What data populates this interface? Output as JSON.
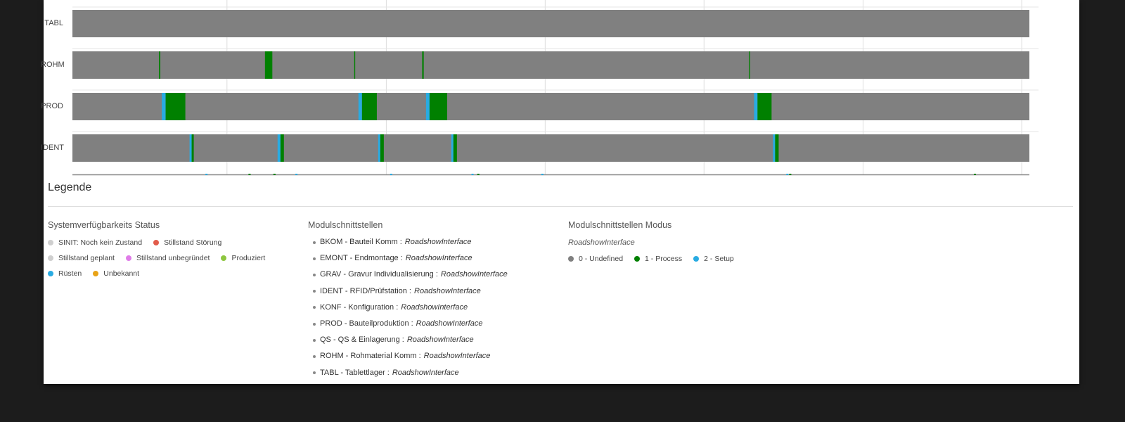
{
  "chart_data": {
    "type": "timeline",
    "rows": [
      {
        "label": "TABL",
        "segments": []
      },
      {
        "label": "ROHM",
        "segments": [
          {
            "start": 0.0905,
            "end": 0.0918,
            "mode": "1"
          },
          {
            "start": 0.2012,
            "end": 0.2089,
            "mode": "1"
          },
          {
            "start": 0.2945,
            "end": 0.2955,
            "mode": "1"
          },
          {
            "start": 0.3655,
            "end": 0.3671,
            "mode": "1"
          },
          {
            "start": 0.7071,
            "end": 0.7081,
            "mode": "1"
          }
        ]
      },
      {
        "label": "PROD",
        "segments": [
          {
            "start": 0.0934,
            "end": 0.0974,
            "mode": "2"
          },
          {
            "start": 0.0974,
            "end": 0.118,
            "mode": "1"
          },
          {
            "start": 0.2989,
            "end": 0.3026,
            "mode": "2"
          },
          {
            "start": 0.3026,
            "end": 0.3181,
            "mode": "1"
          },
          {
            "start": 0.3695,
            "end": 0.3732,
            "mode": "2"
          },
          {
            "start": 0.3732,
            "end": 0.3916,
            "mode": "1"
          },
          {
            "start": 0.7123,
            "end": 0.7159,
            "mode": "2"
          },
          {
            "start": 0.7159,
            "end": 0.7306,
            "mode": "1"
          }
        ]
      },
      {
        "label": "IDENT",
        "segments": [
          {
            "start": 0.1224,
            "end": 0.1246,
            "mode": "2"
          },
          {
            "start": 0.1246,
            "end": 0.1268,
            "mode": "1"
          },
          {
            "start": 0.2144,
            "end": 0.2174,
            "mode": "2"
          },
          {
            "start": 0.2174,
            "end": 0.221,
            "mode": "1"
          },
          {
            "start": 0.3195,
            "end": 0.3217,
            "mode": "2"
          },
          {
            "start": 0.3217,
            "end": 0.3254,
            "mode": "1"
          },
          {
            "start": 0.3959,
            "end": 0.3981,
            "mode": "2"
          },
          {
            "start": 0.3981,
            "end": 0.4018,
            "mode": "1"
          },
          {
            "start": 0.7321,
            "end": 0.7343,
            "mode": "2"
          },
          {
            "start": 0.7343,
            "end": 0.738,
            "mode": "1"
          }
        ]
      }
    ],
    "bottom_ticks": [
      {
        "pos": 0.139,
        "mode": "2"
      },
      {
        "pos": 0.184,
        "mode": "1"
      },
      {
        "pos": 0.21,
        "mode": "1"
      },
      {
        "pos": 0.233,
        "mode": "2"
      },
      {
        "pos": 0.332,
        "mode": "2"
      },
      {
        "pos": 0.417,
        "mode": "2"
      },
      {
        "pos": 0.423,
        "mode": "1"
      },
      {
        "pos": 0.49,
        "mode": "2"
      },
      {
        "pos": 0.746,
        "mode": "2"
      },
      {
        "pos": 0.749,
        "mode": "1"
      },
      {
        "pos": 0.942,
        "mode": "1"
      }
    ],
    "gridlines": [
      0.1615,
      0.328,
      0.494,
      0.66,
      0.8262,
      0.992
    ]
  },
  "legend": {
    "title": "Legende",
    "status": {
      "title": "Systemverfügbarkeits Status",
      "items": [
        {
          "label": "SINIT: Noch kein Zustand",
          "color": "#cfcfcf"
        },
        {
          "label": "Stillstand Störung",
          "color": "#e25c4b"
        },
        {
          "label": "Stillstand geplant",
          "color": "#cfcfcf"
        },
        {
          "label": "Stillstand unbegründet",
          "color": "#e07ce8"
        },
        {
          "label": "Produziert",
          "color": "#8dc63f"
        },
        {
          "label": "Rüsten",
          "color": "#29abe2"
        },
        {
          "label": "Unbekannt",
          "color": "#e8a317"
        }
      ]
    },
    "modules": {
      "title": "Modulschnittstellen",
      "items": [
        {
          "name": "BKOM - Bauteil Komm :",
          "iface": "RoadshowInterface"
        },
        {
          "name": "EMONT - Endmontage :",
          "iface": "RoadshowInterface"
        },
        {
          "name": "GRAV - Gravur Individualisierung :",
          "iface": "RoadshowInterface"
        },
        {
          "name": "IDENT - RFID/Prüfstation :",
          "iface": "RoadshowInterface"
        },
        {
          "name": "KONF - Konfiguration :",
          "iface": "RoadshowInterface"
        },
        {
          "name": "PROD - Bauteilproduktion :",
          "iface": "RoadshowInterface"
        },
        {
          "name": "QS - QS & Einlagerung :",
          "iface": "RoadshowInterface"
        },
        {
          "name": "ROHM - Rohmaterial Komm :",
          "iface": "RoadshowInterface"
        },
        {
          "name": "TABL - Tablettlager :",
          "iface": "RoadshowInterface"
        }
      ]
    },
    "modes": {
      "title": "Modulschnittstellen Modus",
      "interface": "RoadshowInterface",
      "items": [
        {
          "label": "0 - Undefined",
          "color": "#808080"
        },
        {
          "label": "1 - Process",
          "color": "#008000"
        },
        {
          "label": "2 - Setup",
          "color": "#29abe2"
        }
      ]
    }
  }
}
